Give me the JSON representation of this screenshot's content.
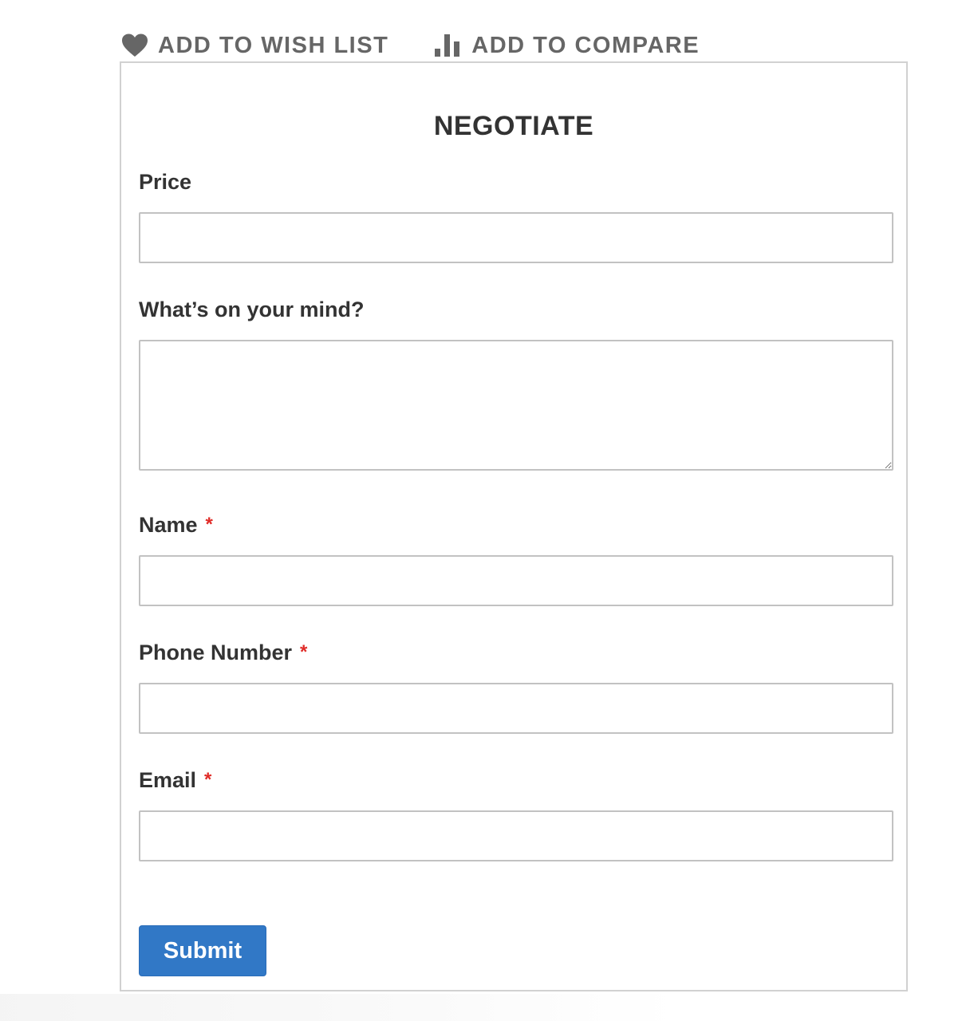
{
  "actions": {
    "wishlist_label": "Add to Wish List",
    "compare_label": "Add to Compare",
    "wishlist_icon": "heart-icon",
    "compare_icon": "bar-chart-icon"
  },
  "form": {
    "title": "NEGOTIATE",
    "price_label": "Price",
    "price_value": "",
    "mind_label": "What’s on your mind?",
    "mind_value": "",
    "name_label": "Name",
    "name_value": "",
    "phone_label": "Phone Number",
    "phone_value": "",
    "email_label": "Email",
    "email_value": "",
    "required_marker": "*",
    "submit_label": "Submit"
  },
  "colors": {
    "accent": "#3178c6",
    "required": "#e02b27",
    "border": "#c2c2c2",
    "panel_border": "#d1d1d1",
    "action_text": "#666666"
  }
}
